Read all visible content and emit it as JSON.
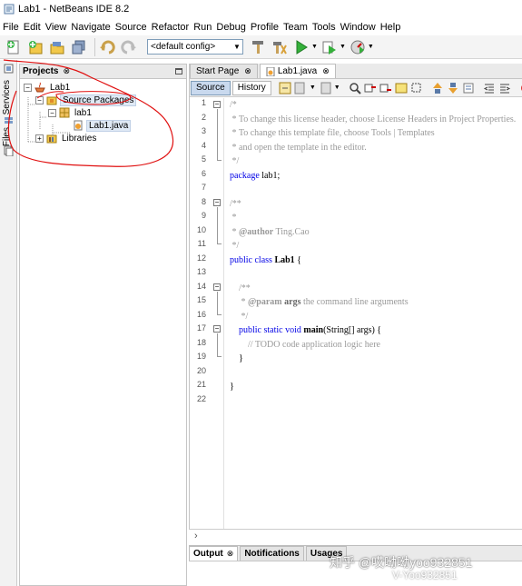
{
  "window": {
    "title": "Lab1 - NetBeans IDE 8.2"
  },
  "menu": [
    "File",
    "Edit",
    "View",
    "Navigate",
    "Source",
    "Refactor",
    "Run",
    "Debug",
    "Profile",
    "Team",
    "Tools",
    "Window",
    "Help"
  ],
  "toolbar": {
    "config": "<default config>",
    "icons": [
      "new-file-icon",
      "new-project-icon",
      "open-project-icon",
      "save-all-icon",
      "undo-icon",
      "redo-icon",
      "build-icon",
      "clean-build-icon",
      "run-icon",
      "debug-icon",
      "profile-icon"
    ]
  },
  "side_tabs": {
    "services": "Services",
    "files": "Files"
  },
  "projects_panel": {
    "title": "Projects",
    "close": "⊗",
    "tree": [
      {
        "label": "Lab1",
        "icon": "project-icon"
      },
      {
        "label": "Source Packages",
        "icon": "source-packages-icon"
      },
      {
        "label": "lab1",
        "icon": "package-icon"
      },
      {
        "label": "Lab1.java",
        "icon": "java-file-icon"
      },
      {
        "label": "Libraries",
        "icon": "libraries-icon"
      }
    ]
  },
  "editor": {
    "tabs": [
      {
        "label": "Start Page",
        "close": "⊗"
      },
      {
        "label": "Lab1.java",
        "close": "⊗"
      }
    ],
    "source_btn": "Source",
    "history_btn": "History",
    "lines": [
      "1",
      "2",
      "3",
      "4",
      "5",
      "6",
      "7",
      "8",
      "9",
      "10",
      "11",
      "12",
      "13",
      "14",
      "15",
      "16",
      "17",
      "18",
      "19",
      "20",
      "21",
      "22"
    ],
    "code": {
      "l1": "/*",
      "l2": " * To change this license header, choose License Headers in Project Properties.",
      "l3": " * To change this template file, choose Tools | Templates",
      "l4": " * and open the template in the editor.",
      "l5": " */",
      "l6_kw": "package",
      "l6_rest": " lab1;",
      "l8": "/**",
      "l9": " *",
      "l10_pre": " * ",
      "l10_tag": "@author",
      "l10_rest": " Ting.Cao",
      "l11": " */",
      "l12_kw": "public class",
      "l12_name": " Lab1",
      "l12_rest": " {",
      "l14": "    /**",
      "l15_pre": "     * ",
      "l15_tag": "@param",
      "l15_name": " args",
      "l15_rest": " the command line arguments",
      "l16": "     */",
      "l17_kw": "    public static void",
      "l17_name": " main",
      "l17_rest": "(String[] args) {",
      "l18": "        // TODO code application logic here",
      "l19": "    }",
      "l21": "}"
    }
  },
  "output": {
    "tabs": [
      {
        "label": "Output",
        "close": "⊗"
      },
      {
        "label": "Notifications"
      },
      {
        "label": "Usages"
      }
    ]
  },
  "watermark": {
    "line1": "知乎 @哎呦呦yoo932851",
    "line2": "V-Yoo932851"
  },
  "colors": {
    "keyword": "#0000e6",
    "comment": "#999999",
    "annotation": "#e01010"
  }
}
